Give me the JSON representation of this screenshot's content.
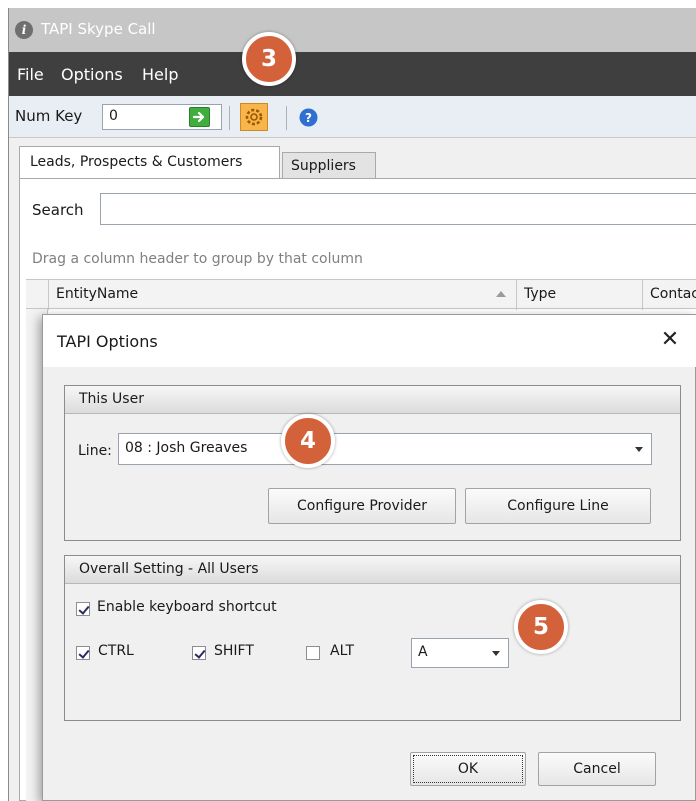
{
  "window": {
    "title": "TAPI Skype Call",
    "menu": [
      "File",
      "Options",
      "Help"
    ]
  },
  "toolbar": {
    "num_key_label": "Num Key",
    "num_key_value": "0",
    "icons": [
      "green-arrow-icon",
      "gear-icon",
      "help-icon"
    ]
  },
  "tabs": [
    "Leads, Prospects & Customers",
    "Suppliers"
  ],
  "search": {
    "label": "Search",
    "value": ""
  },
  "grid": {
    "group_hint": "Drag a column header to group by that column",
    "columns": [
      "EntityName",
      "Type",
      "Contac"
    ]
  },
  "dialog": {
    "title": "TAPI Options",
    "this_user": {
      "header": "This User",
      "line_label": "Line:",
      "line_value": "08 : Josh Greaves",
      "configure_provider": "Configure Provider",
      "configure_line": "Configure Line"
    },
    "overall": {
      "header": "Overall Setting - All Users",
      "enable_shortcut": {
        "label": "Enable keyboard shortcut",
        "checked": true
      },
      "ctrl": {
        "label": "CTRL",
        "checked": true
      },
      "shift": {
        "label": "SHIFT",
        "checked": true
      },
      "alt": {
        "label": "ALT",
        "checked": false
      },
      "key_value": "A"
    },
    "ok": "OK",
    "cancel": "Cancel"
  },
  "callouts": [
    "3",
    "4",
    "5"
  ],
  "colors": {
    "menubar": "#3f3f3f",
    "titlebar": "#c6c6c6",
    "callout": "#d3613a",
    "gear": "#f7b54c"
  }
}
